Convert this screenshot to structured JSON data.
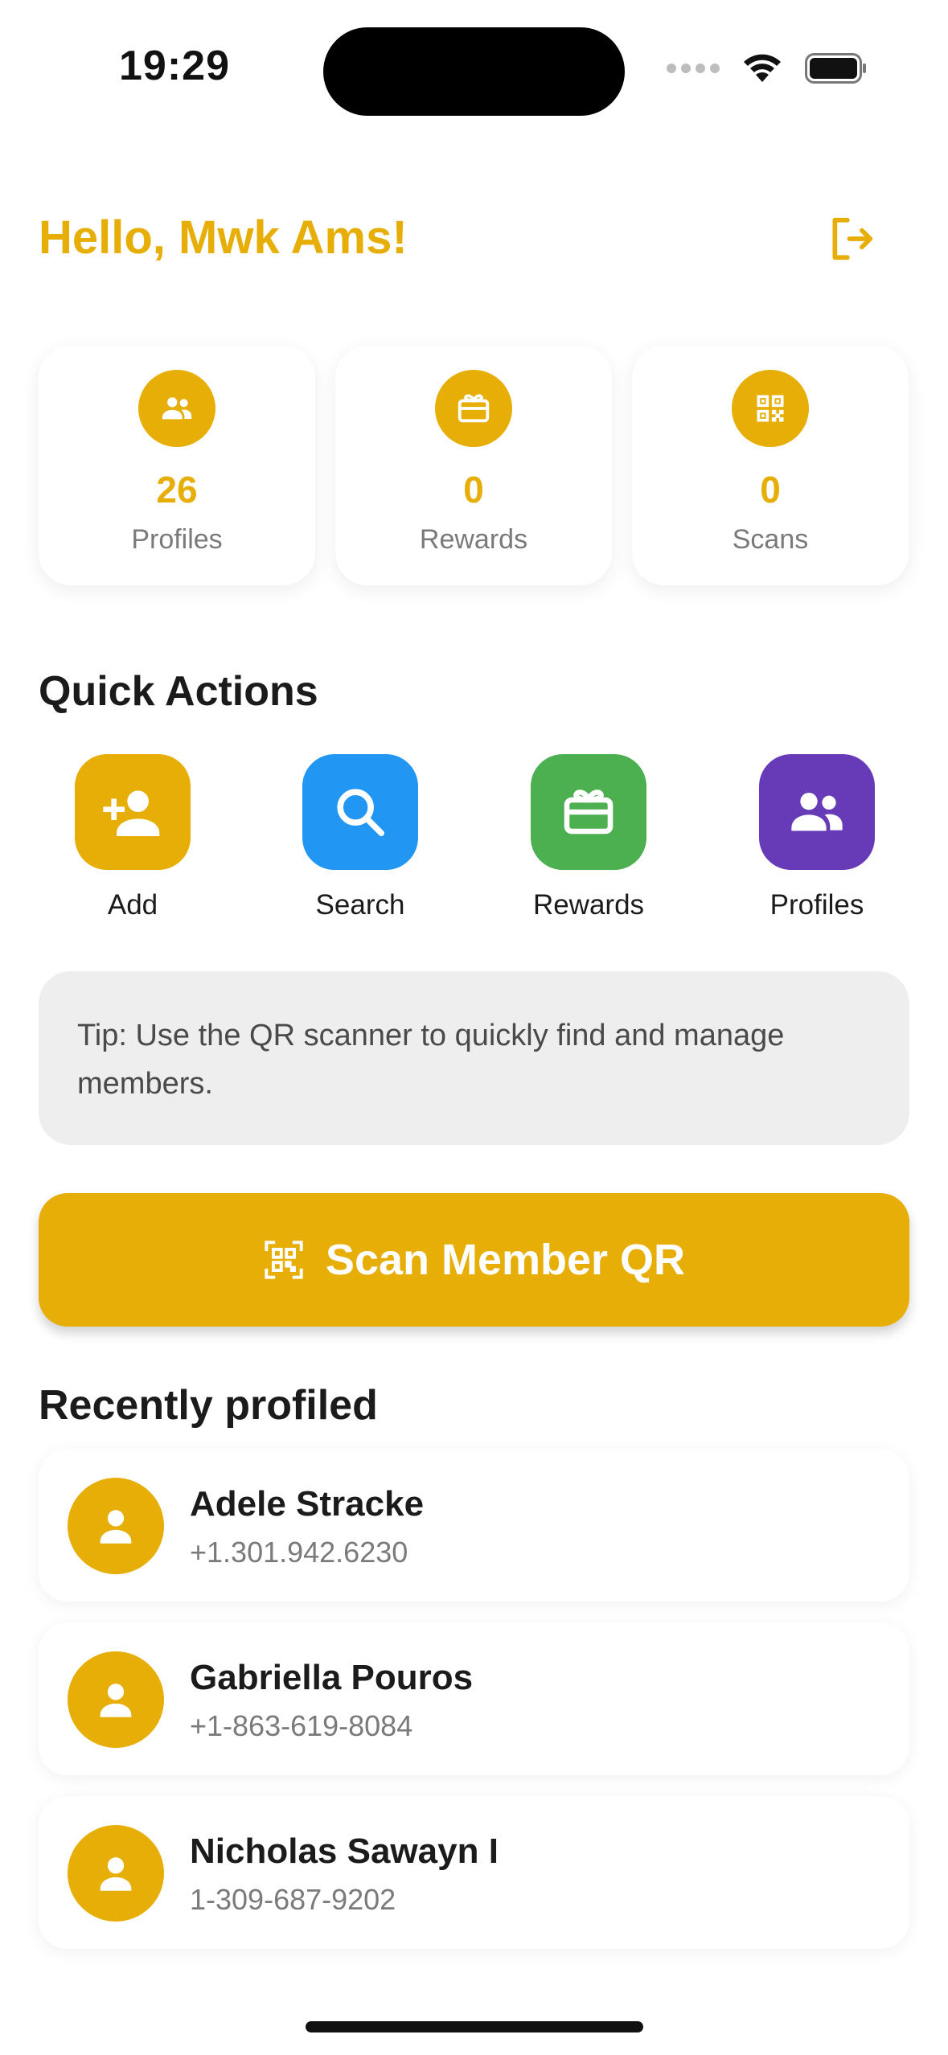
{
  "status_bar": {
    "time": "19:29"
  },
  "header": {
    "greeting": "Hello, Mwk Ams!"
  },
  "stats": [
    {
      "value": "26",
      "label": "Profiles",
      "icon": "people-icon"
    },
    {
      "value": "0",
      "label": "Rewards",
      "icon": "gift-card-icon"
    },
    {
      "value": "0",
      "label": "Scans",
      "icon": "qr-code-icon"
    }
  ],
  "quick_actions": {
    "title": "Quick Actions",
    "items": [
      {
        "label": "Add",
        "icon": "person-add-icon",
        "color": "#e6ae07"
      },
      {
        "label": "Search",
        "icon": "search-icon",
        "color": "#2196f3"
      },
      {
        "label": "Rewards",
        "icon": "gift-card-icon",
        "color": "#4caf50"
      },
      {
        "label": "Profiles",
        "icon": "people-icon",
        "color": "#673ab7"
      }
    ]
  },
  "tip": {
    "text": "Tip: Use the QR scanner to quickly find and manage members."
  },
  "scan_button": {
    "label": "Scan Member QR",
    "icon": "qr-scanner-icon"
  },
  "recent": {
    "title": "Recently profiled",
    "items": [
      {
        "name": "Adele Stracke",
        "phone": "+1.301.942.6230"
      },
      {
        "name": "Gabriella Pouros",
        "phone": "+1-863-619-8084"
      },
      {
        "name": "Nicholas Sawayn I",
        "phone": "1-309-687-9202"
      }
    ]
  },
  "colors": {
    "accent": "#e6ae07",
    "tip_bg": "#eeeeee"
  }
}
